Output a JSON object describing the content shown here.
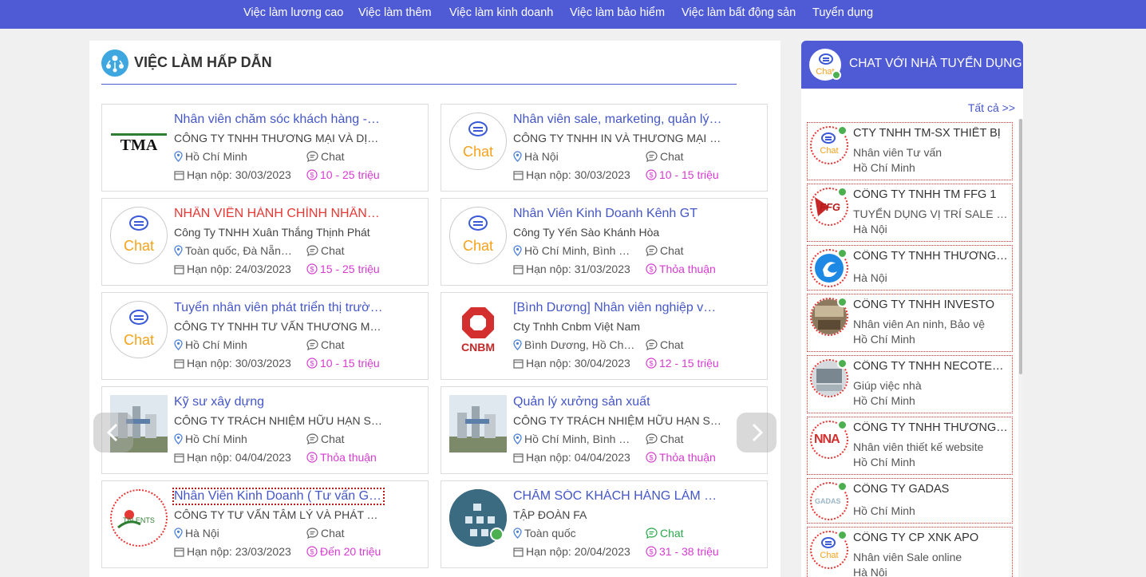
{
  "nav": {
    "items": [
      "Việc làm lương cao",
      "Việc làm thêm",
      "Việc làm kinh doanh",
      "Việc làm bảo hiểm",
      "Việc làm bất động sản",
      "Tuyển dụng"
    ]
  },
  "section": {
    "title": "VIỆC LÀM HẤP DẪN"
  },
  "jobs": [
    {
      "title": "Nhân viên chăm sóc khách hàng - Chăm sóc khách hàng",
      "company": "CÔNG TY TNHH THƯƠNG MẠI VÀ DỊCH VỤ TMA",
      "location": "Hồ Chí Minh",
      "chat": "Chat",
      "deadline": "Hạn nộp: 30/03/2023",
      "salary": "10 - 25 triệu",
      "logo": "tma-logo",
      "logo_text": "TMA"
    },
    {
      "title": "Nhân viên sale, marketing, quản lý, kinh doanh",
      "company": "CÔNG TY TNHH IN VÀ THƯƠNG MẠI GIA PHÁT",
      "location": "Hà Nội",
      "chat": "Chat",
      "deadline": "Hạn nộp: 30/03/2023",
      "salary": "10 - 15 triệu",
      "logo": "chat-logo",
      "logo_text": "Chat"
    },
    {
      "title": "NHÂN VIÊN HÀNH CHÍNH NHÂN SỰ",
      "company": "Công Ty TNHH Xuân Thắng Thịnh Phát",
      "location": "Toàn quốc, Đà Nẵng, Hà Nội",
      "chat": "Chat",
      "deadline": "Hạn nộp: 24/03/2023",
      "salary": "15 - 25 triệu",
      "logo": "chat-logo",
      "logo_text": "Chat"
    },
    {
      "title": "Nhân Viên Kinh Doanh Kênh GT",
      "company": "Công Ty Yến Sào Khánh Hòa",
      "location": "Hồ Chí Minh, Bình Dương",
      "chat": "Chat",
      "deadline": "Hạn nộp: 31/03/2023",
      "salary": "Thỏa thuận",
      "logo": "chat-logo",
      "logo_text": "Chat"
    },
    {
      "title": "Tuyển nhân viên phát triển thị trường",
      "company": "CÔNG TY TNHH TƯ VẤN THƯƠNG MẠI DỊCH VỤ",
      "location": "Hồ Chí Minh",
      "chat": "Chat",
      "deadline": "Hạn nộp: 30/03/2023",
      "salary": "10 - 15 triệu",
      "logo": "chat-logo",
      "logo_text": "Chat"
    },
    {
      "title": "[Bình Dương] Nhân viên nghiệp vụ kinh doanh",
      "company": "Cty Tnhh Cnbm Việt Nam",
      "location": "Bình Dương, Hồ Chí Minh",
      "chat": "Chat",
      "deadline": "Hạn nộp: 30/04/2023",
      "salary": "12 - 15 triệu",
      "logo": "cnbm-logo",
      "logo_text": "CNBM"
    },
    {
      "title": "Kỹ sư xây dựng",
      "company": "CÔNG TY TRÁCH NHIỆM HỮU HẠN SOCO",
      "location": "Hồ Chí Minh",
      "chat": "Chat",
      "deadline": "Hạn nộp: 04/04/2023",
      "salary": "Thỏa thuận",
      "logo": "factory-photo",
      "logo_text": ""
    },
    {
      "title": "Quản lý xưởng sản xuất",
      "company": "CÔNG TY TRÁCH NHIỆM HỮU HẠN SOCO",
      "location": "Hồ Chí Minh, Bình Dương",
      "chat": "Chat",
      "deadline": "Hạn nộp: 04/04/2023",
      "salary": "Thỏa thuận",
      "logo": "factory-photo",
      "logo_text": ""
    },
    {
      "title": "Nhân Viên Kinh Doanh ( Tư vấn Giáo dục )",
      "company": "CÔNG TY TƯ VẤN TÂM LÝ VÀ PHÁT TRIỂN TALENTS",
      "location": "Hà Nội",
      "chat": "Chat",
      "deadline": "Hạn nộp: 23/03/2023",
      "salary": "Đến 20 triệu",
      "logo": "talents-logo",
      "logo_text": "TALENTS"
    },
    {
      "title": "CHĂM SÓC KHÁCH HÀNG LÀM VIỆC TẠI NHÀ",
      "company": "TẬP ĐOÀN FA",
      "location": "Toàn quốc",
      "chat": "Chat",
      "deadline": "Hạn nộp: 20/04/2023",
      "salary": "31 - 38 triệu",
      "logo": "network-photo",
      "logo_text": ""
    }
  ],
  "sidebar": {
    "title": "CHAT VỚI NHÀ TUYỂN DỤNG",
    "header_icon_text": "Chat",
    "see_all": "Tất cả >>",
    "recruiters": [
      {
        "name": "CTY TNHH TM-SX THIẾT BỊ",
        "position": "Nhân viên Tư vấn",
        "location": "Hồ Chí Minh",
        "logo": "chat-logo",
        "logo_text": "Chat"
      },
      {
        "name": "CÔNG TY TNHH TM FFG 1",
        "position": "TUYỂN DỤNG VỊ TRÍ SALE văn phòng",
        "location": "Hà Nội",
        "logo": "ffg-logo",
        "logo_text": "FFG"
      },
      {
        "name": "CÔNG TY TNHH THƯƠNG MẠI",
        "position": "",
        "location": "Hà Nội",
        "logo": "swirl-logo",
        "logo_text": ""
      },
      {
        "name": "CÔNG TY TNHH INVESTO",
        "position": "Nhân viên An ninh, Bảo vệ",
        "location": "Hồ Chí Minh",
        "logo": "office-photo",
        "logo_text": ""
      },
      {
        "name": "CÔNG TY TNHH NECOTEK VIỆT NAM",
        "position": "Giúp việc nhà",
        "location": "Hồ Chí Minh",
        "logo": "room-photo",
        "logo_text": ""
      },
      {
        "name": "CÔNG TY TNHH THƯƠNG MẠI",
        "position": "Nhân viên thiết kế website",
        "location": "Hồ Chí Minh",
        "logo": "nna-logo",
        "logo_text": "NNA"
      },
      {
        "name": "CÔNG TY GADAS",
        "position": "",
        "location": "Hồ Chí Minh",
        "logo": "gadas-logo",
        "logo_text": "GADAS"
      },
      {
        "name": "CÔNG TY CP XNK APO",
        "position": "Nhân viên Sale online",
        "location": "Hà Nội",
        "logo": "chat-logo",
        "logo_text": "Chat"
      }
    ]
  },
  "colors": {
    "brand": "#4f5bd5",
    "title_blue": "#4557c7",
    "salary_pink": "#d63bd0",
    "online_green": "#4caf50",
    "chat_orange": "#f7a21b"
  }
}
